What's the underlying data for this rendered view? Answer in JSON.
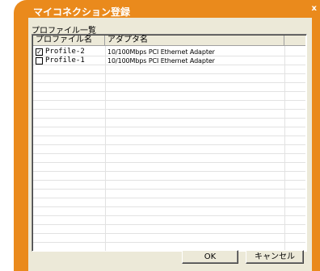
{
  "window": {
    "title": "マイコネクション登録",
    "close_glyph": "x",
    "accent_color": "#ea8a1c"
  },
  "profiles_section": {
    "label": "プロファイル一覧",
    "columns": [
      "プロファイル名",
      "アダプタ名"
    ],
    "rows": [
      {
        "checked": true,
        "name": "Profile-2",
        "adapter": "10/100Mbps PCI Ethernet Adapter"
      },
      {
        "checked": false,
        "name": "Profile-1",
        "adapter": "10/100Mbps PCI Ethernet Adapter"
      }
    ]
  },
  "buttons": {
    "ok_label": "OK",
    "cancel_label": "キャンセル"
  }
}
